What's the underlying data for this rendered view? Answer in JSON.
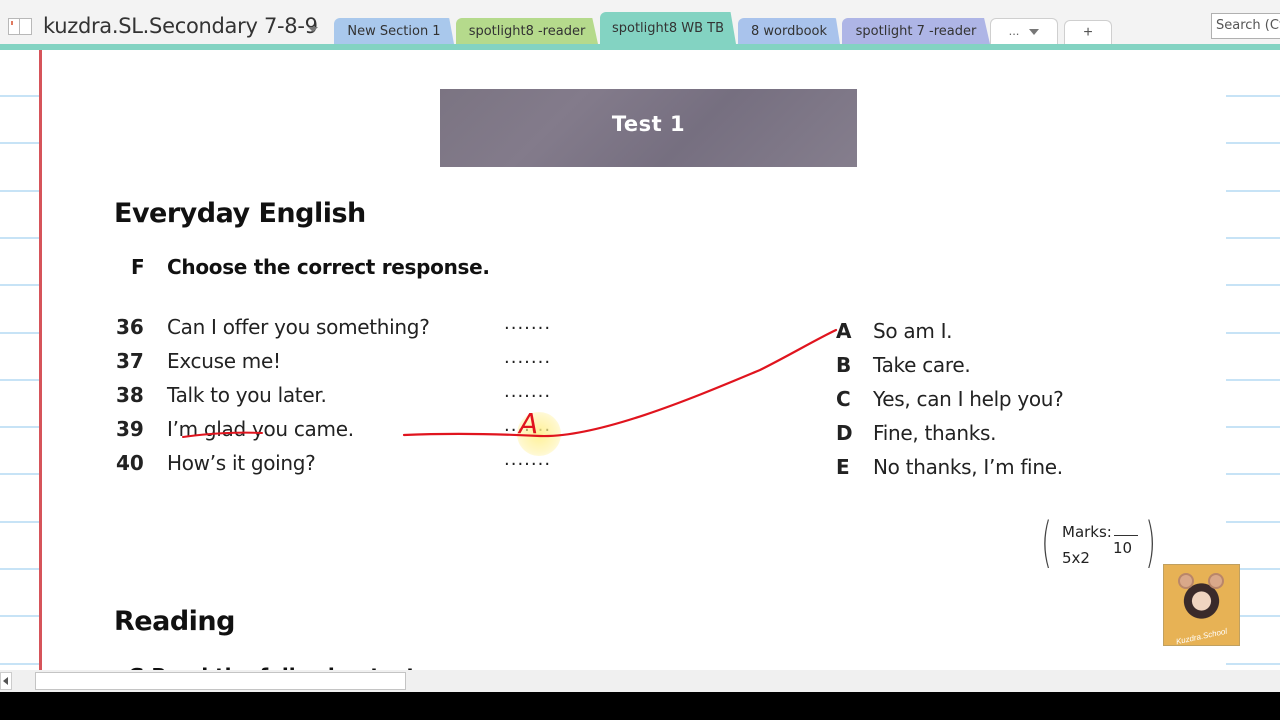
{
  "app": {
    "notebook_title": "kuzdra.SL.Secondary 7-8-9",
    "search_placeholder": "Search (Ctrl+E)"
  },
  "section_tabs": [
    {
      "label": "New Section 1",
      "color": "#a9c8ec",
      "active": false
    },
    {
      "label": "spotlight8 -reader",
      "color": "#b5da8c",
      "active": false
    },
    {
      "label": "spotlight8 WB TB",
      "color": "#83d3c2",
      "active": true
    },
    {
      "label": "8 wordbook",
      "color": "#a9c3ec",
      "active": false
    },
    {
      "label": "spotlight 7 -reader",
      "color": "#aeb5e6",
      "active": false
    }
  ],
  "tab_overflow_label": "...",
  "tab_add_label": "+",
  "page": {
    "banner_title": "Test 1",
    "section_title": "Everyday English",
    "task_letter": "F",
    "task_instruction": "Choose the correct response.",
    "questions": [
      {
        "number": "36",
        "text": "Can I offer you something?",
        "blank": ".......",
        "answer": ""
      },
      {
        "number": "37",
        "text": "Excuse me!",
        "blank": ".......",
        "answer": ""
      },
      {
        "number": "38",
        "text": "Talk to you later.",
        "blank": ".......",
        "answer": ""
      },
      {
        "number": "39",
        "text": "I’m glad you came.",
        "blank": ".......",
        "answer": "A"
      },
      {
        "number": "40",
        "text": "How’s it going?",
        "blank": ".......",
        "answer": ""
      }
    ],
    "responses": [
      {
        "letter": "A",
        "text": "So am I."
      },
      {
        "letter": "B",
        "text": "Take care."
      },
      {
        "letter": "C",
        "text": "Yes, can I help you?"
      },
      {
        "letter": "D",
        "text": "Fine, thanks."
      },
      {
        "letter": "E",
        "text": "No thanks, I’m fine."
      }
    ],
    "marks": {
      "label": "Marks:",
      "formula": "5x2",
      "total": "10"
    },
    "next_section_title": "Reading",
    "next_task_partial": "G   Read the following text..."
  },
  "avatar_caption": "Kuzdra.School",
  "annotation": {
    "ink_color": "#e0141e",
    "handwritten_answer": "A"
  }
}
